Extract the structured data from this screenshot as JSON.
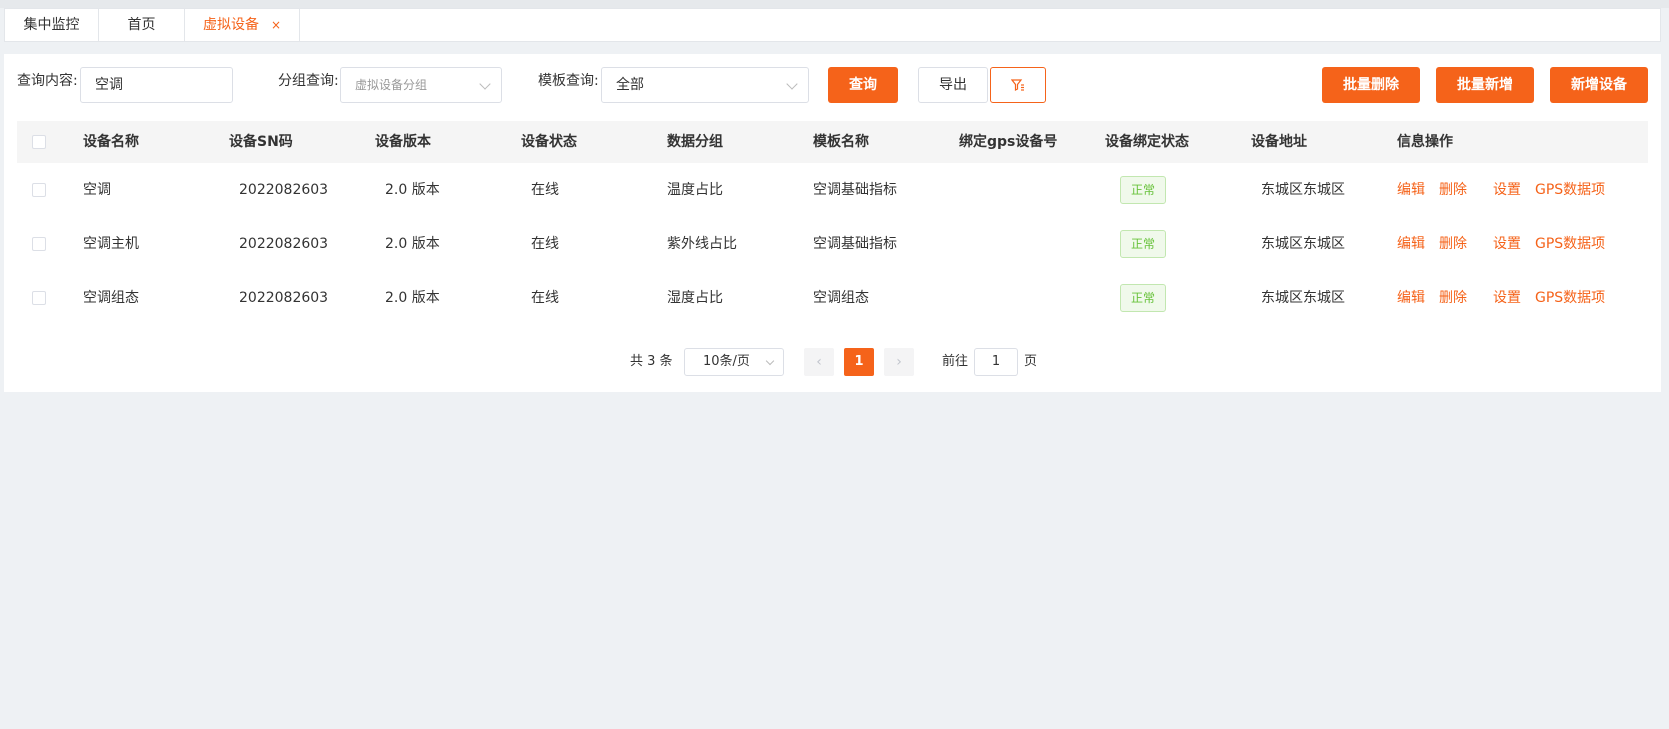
{
  "tabs": [
    {
      "label": "集中监控"
    },
    {
      "label": "首页"
    },
    {
      "label": "虚拟设备",
      "close": "×"
    }
  ],
  "filters": {
    "query_label": "查询内容:",
    "query_value": "空调",
    "group_label": "分组查询:",
    "group_placeholder": "虚拟设备分组",
    "template_label": "模板查询:",
    "template_value": "全部"
  },
  "buttons": {
    "search": "查询",
    "export": "导出",
    "batch_delete": "批量删除",
    "batch_add": "批量新增",
    "add_device": "新增设备"
  },
  "table": {
    "headers": [
      "设备名称",
      "设备SN码",
      "设备版本",
      "设备状态",
      "数据分组",
      "模板名称",
      "绑定gps设备号",
      "设备绑定状态",
      "设备地址",
      "信息操作"
    ],
    "rows": [
      {
        "name": "空调",
        "sn": "2022082603",
        "version": "2.0 版本",
        "status": "在线",
        "group": "温度占比",
        "template": "空调基础指标",
        "gps": "",
        "bind_status": "正常",
        "address": "东城区东城区"
      },
      {
        "name": "空调主机",
        "sn": "2022082603",
        "version": "2.0 版本",
        "status": "在线",
        "group": "紫外线占比",
        "template": "空调基础指标",
        "gps": "",
        "bind_status": "正常",
        "address": "东城区东城区"
      },
      {
        "name": "空调组态",
        "sn": "2022082603",
        "version": "2.0 版本",
        "status": "在线",
        "group": "湿度占比",
        "template": "空调组态",
        "gps": "",
        "bind_status": "正常",
        "address": "东城区东城区"
      }
    ],
    "actions": {
      "edit": "编辑",
      "delete": "删除",
      "settings": "设置",
      "gps": "GPS数据项"
    }
  },
  "pagination": {
    "total": "共 3 条",
    "page_size": "10条/页",
    "current": "1",
    "goto_label": "前往",
    "goto_value": "1",
    "page_suffix": "页"
  },
  "colors": {
    "accent": "#f5631a",
    "success": "#67c23a"
  },
  "icons": {
    "filter": "filter-icon",
    "prev": "chevron-left-icon",
    "next": "chevron-right-icon",
    "dropdown": "chevron-down-icon",
    "close": "close-icon"
  }
}
